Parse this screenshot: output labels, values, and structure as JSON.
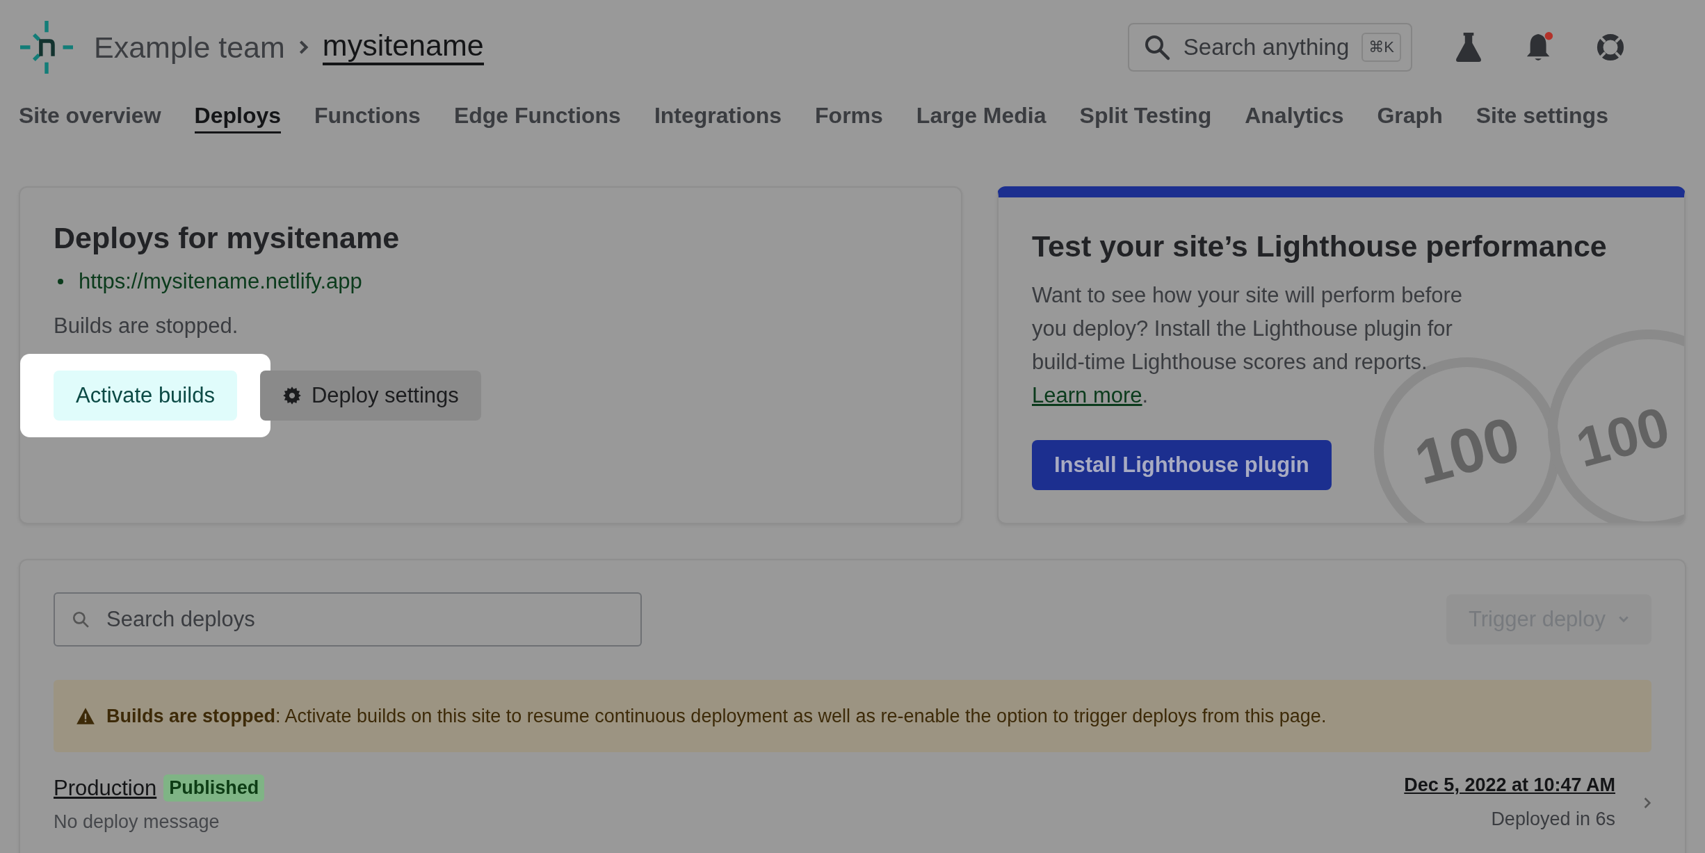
{
  "header": {
    "team": "Example team",
    "site": "mysitename",
    "search": {
      "placeholder": "Search anything",
      "shortcut": "⌘K"
    },
    "has_notification": true
  },
  "nav": [
    {
      "label": "Site overview",
      "selected": false
    },
    {
      "label": "Deploys",
      "selected": true
    },
    {
      "label": "Functions",
      "selected": false
    },
    {
      "label": "Edge Functions",
      "selected": false
    },
    {
      "label": "Integrations",
      "selected": false
    },
    {
      "label": "Forms",
      "selected": false
    },
    {
      "label": "Large Media",
      "selected": false
    },
    {
      "label": "Split Testing",
      "selected": false
    },
    {
      "label": "Analytics",
      "selected": false
    },
    {
      "label": "Graph",
      "selected": false
    },
    {
      "label": "Site settings",
      "selected": false
    }
  ],
  "deploy_card": {
    "title": "Deploys for mysitename",
    "url": "https://mysitename.netlify.app",
    "status": "Builds are stopped.",
    "buttons": [
      {
        "label": "Activate builds",
        "kind": "primary",
        "highlighted": true
      },
      {
        "label": "Deploy settings",
        "kind": "settings",
        "highlighted": false
      }
    ]
  },
  "lighthouse_card": {
    "title": "Test your site’s Lighthouse performance",
    "text": "Want to see how your site will perform before you deploy? Install the Lighthouse plugin for build-time Lighthouse scores and reports.",
    "link": "Learn more",
    "link_suffix": ".",
    "button": "Install Lighthouse plugin",
    "badges": [
      "100",
      "100"
    ]
  },
  "deploys": {
    "search_placeholder": "Search deploys",
    "trigger": {
      "label": "Trigger deploy",
      "disabled": true
    },
    "alert": "**Builds are stopped**: Activate builds on this site to resume continuous deployment as well as re-enable the option to trigger deploys from this page.",
    "rows": [
      {
        "context": "Production",
        "badge": "Published",
        "message": "No deploy message",
        "date": "Dec 5, 2022 at 10:47 AM",
        "duration": "Deployed in 6s"
      }
    ]
  }
}
